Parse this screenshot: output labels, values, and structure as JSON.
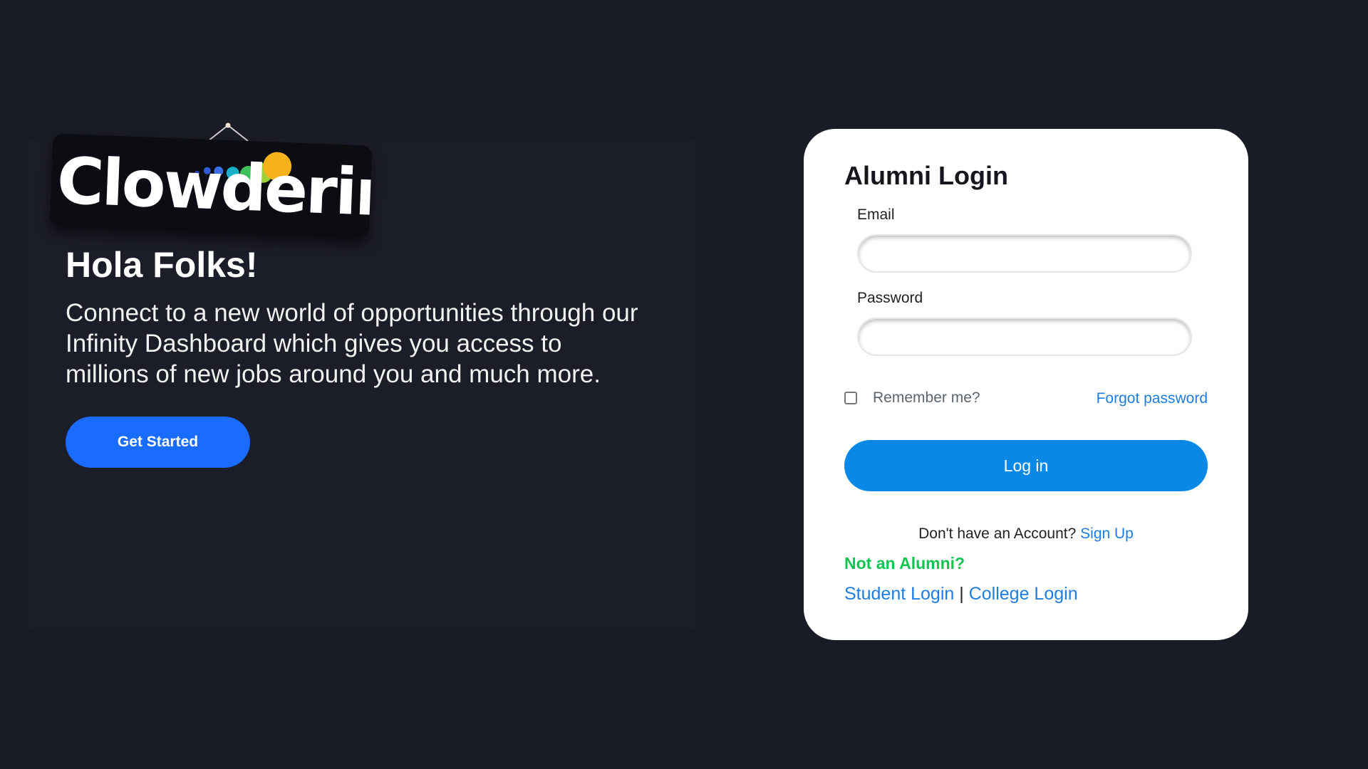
{
  "brand": {
    "logo_text": "Clowderin"
  },
  "hero": {
    "heading": "Hola Folks!",
    "description": "Connect to a new world of opportunities through our Infinity Dashboard which gives you access to millions of new jobs around you and much more.",
    "cta_label": "Get Started"
  },
  "login": {
    "title": "Alumni Login",
    "email_label": "Email",
    "email_value": "",
    "password_label": "Password",
    "password_value": "",
    "remember_label": "Remember me?",
    "remember_checked": false,
    "forgot_label": "Forgot password",
    "submit_label": "Log in",
    "signup_prompt": "Don't have an Account?",
    "signup_label": "Sign Up",
    "not_alumni_label": "Not an Alumni?",
    "student_login_label": "Student Login",
    "separator": "|",
    "college_login_label": "College Login"
  },
  "colors": {
    "background": "#191b26",
    "primary_button": "#0a88e8",
    "cta_button": "#1a6bff",
    "link": "#1e7de0",
    "not_alumni": "#12c451"
  },
  "icons": {
    "logo_dots": "colored-bubbles-icon",
    "hanging_string": "hanging-string-icon"
  }
}
